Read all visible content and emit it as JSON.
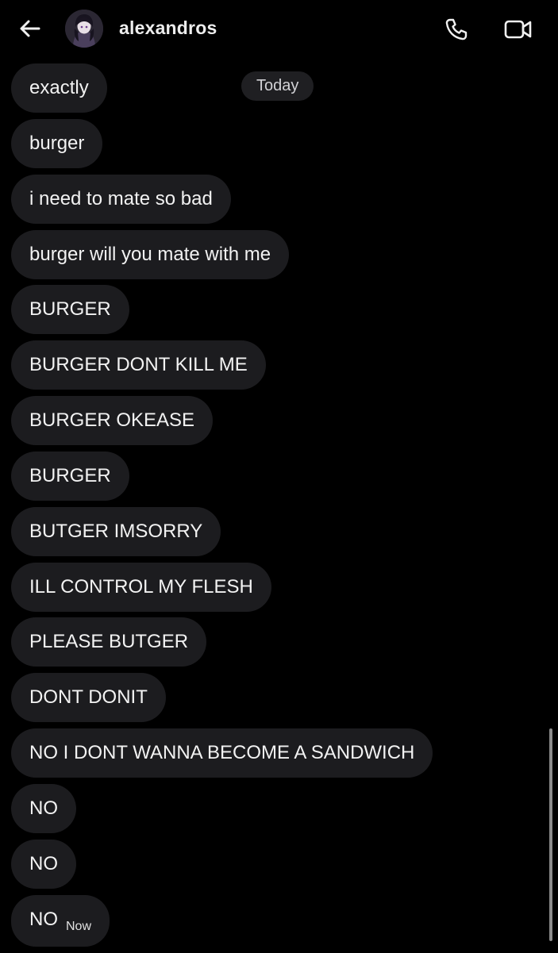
{
  "header": {
    "username": "alexandros",
    "back_icon": "arrow-left-icon",
    "call_icon": "phone-icon",
    "video_icon": "video-camera-icon"
  },
  "date_separator": "Today",
  "messages": [
    {
      "text": "exactly"
    },
    {
      "text": "burger"
    },
    {
      "text": "i need to mate so bad"
    },
    {
      "text": "burger will you mate with me"
    },
    {
      "text": "BURGER"
    },
    {
      "text": "BURGER DONT KILL ME"
    },
    {
      "text": "BURGER OKEASE"
    },
    {
      "text": "BURGER"
    },
    {
      "text": "BUTGER IMSORRY"
    },
    {
      "text": "ILL CONTROL MY FLESH"
    },
    {
      "text": "PLEASE BUTGER"
    },
    {
      "text": "DONT DONIT"
    },
    {
      "text": "NO I DONT WANNA BECOME A SANDWICH"
    },
    {
      "text": "NO"
    },
    {
      "text": "NO"
    },
    {
      "text": "NO",
      "time": "Now"
    }
  ],
  "colors": {
    "background": "#000000",
    "bubble": "#1c1c1f",
    "text": "#f2f2f2"
  }
}
